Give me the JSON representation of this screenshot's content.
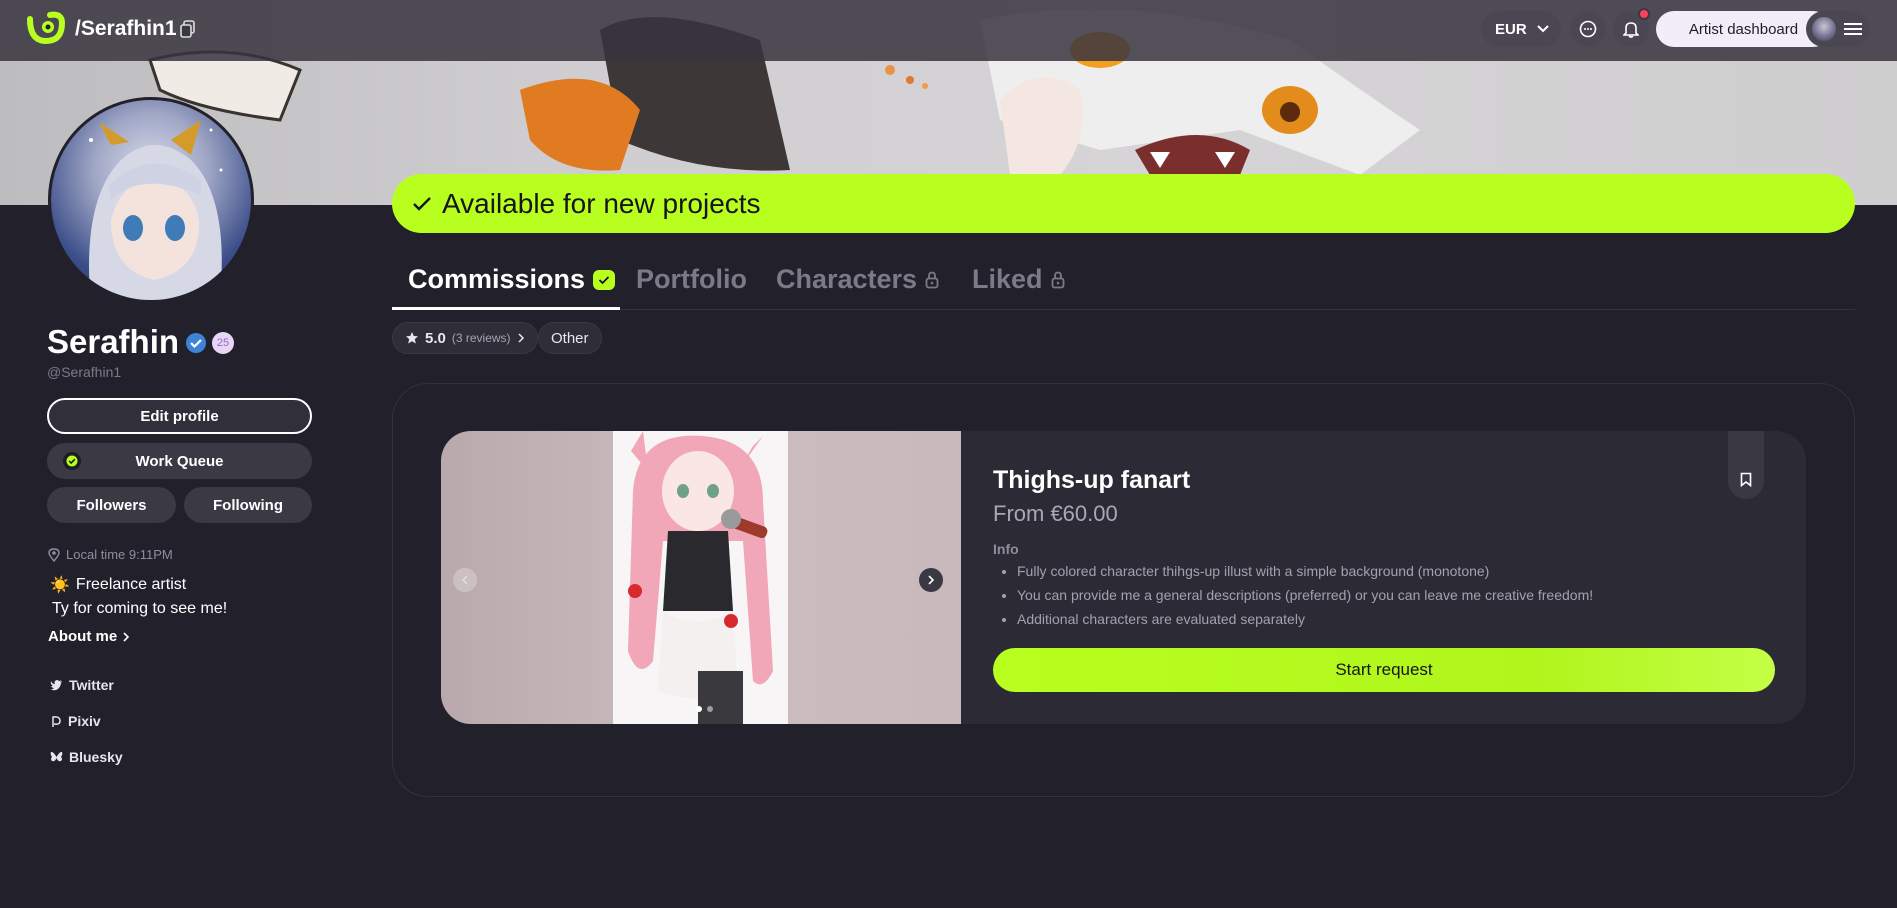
{
  "topbar": {
    "title": "/Serafhin1",
    "currency": "EUR",
    "artist_dashboard": "Artist dashboard"
  },
  "profile": {
    "name": "Serafhin",
    "badge_count": "25",
    "handle": "@Serafhin1",
    "edit_profile": "Edit profile",
    "work_queue": "Work Queue",
    "followers": "Followers",
    "following": "Following",
    "local_time": "Local time 9:11PM",
    "bio_line1": "Freelance artist",
    "bio_line1_emoji": "☀️",
    "bio_line2": "Ty for coming to see me!",
    "about_me": "About me",
    "socials": [
      {
        "label": "Twitter",
        "icon": "twitter-icon"
      },
      {
        "label": "Pixiv",
        "icon": "pixiv-icon"
      },
      {
        "label": "Bluesky",
        "icon": "bluesky-icon"
      }
    ]
  },
  "availability": "Available for new projects",
  "tabs": [
    {
      "label": "Commissions",
      "active": true
    },
    {
      "label": "Portfolio"
    },
    {
      "label": "Characters",
      "locked": true
    },
    {
      "label": "Liked",
      "locked": true
    }
  ],
  "filters": {
    "rating": "5.0",
    "reviews": "(3 reviews)",
    "other": "Other"
  },
  "commission": {
    "title": "Thighs-up fanart",
    "price": "From €60.00",
    "info_label": "Info",
    "info_items": [
      "Fully colored character thihgs-up illust with a simple background (monotone)",
      "You can provide me a general descriptions (preferred) or you can leave me creative freedom!",
      "Additional characters are evaluated separately"
    ],
    "start_request": "Start request"
  },
  "colors": {
    "accent": "#b8ff1f",
    "background": "#22212b",
    "card": "#2c2b35"
  }
}
